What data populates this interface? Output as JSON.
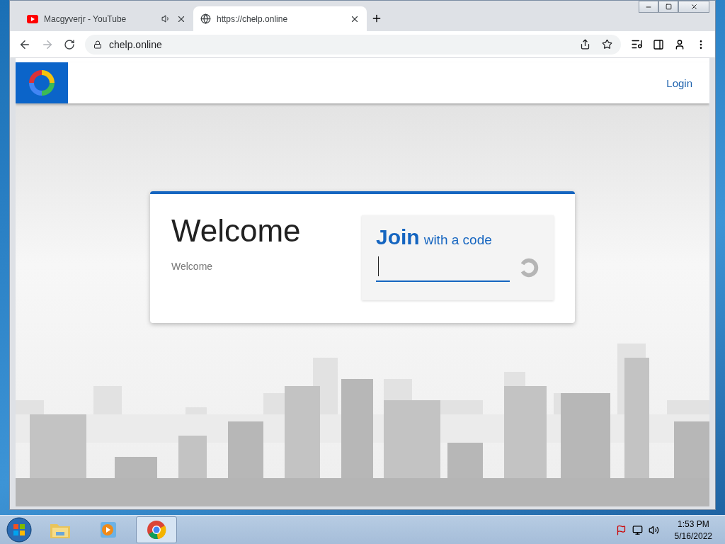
{
  "tabs": [
    {
      "title": "Macgyverjr - YouTube",
      "kind": "youtube",
      "selected": false,
      "audio": true
    },
    {
      "title": "https://chelp.online",
      "kind": "globe",
      "selected": true,
      "audio": false
    }
  ],
  "address": "chelp.online",
  "header": {
    "login": "Login"
  },
  "card": {
    "title": "Welcome",
    "subtitle": "Welcome",
    "join_word": "Join",
    "join_rest": "with a code"
  },
  "taskbar": {
    "items": [
      {
        "kind": "explorer",
        "selected": false
      },
      {
        "kind": "media",
        "selected": false
      },
      {
        "kind": "chrome",
        "selected": true
      }
    ],
    "time": "1:53 PM",
    "date": "5/16/2022"
  }
}
